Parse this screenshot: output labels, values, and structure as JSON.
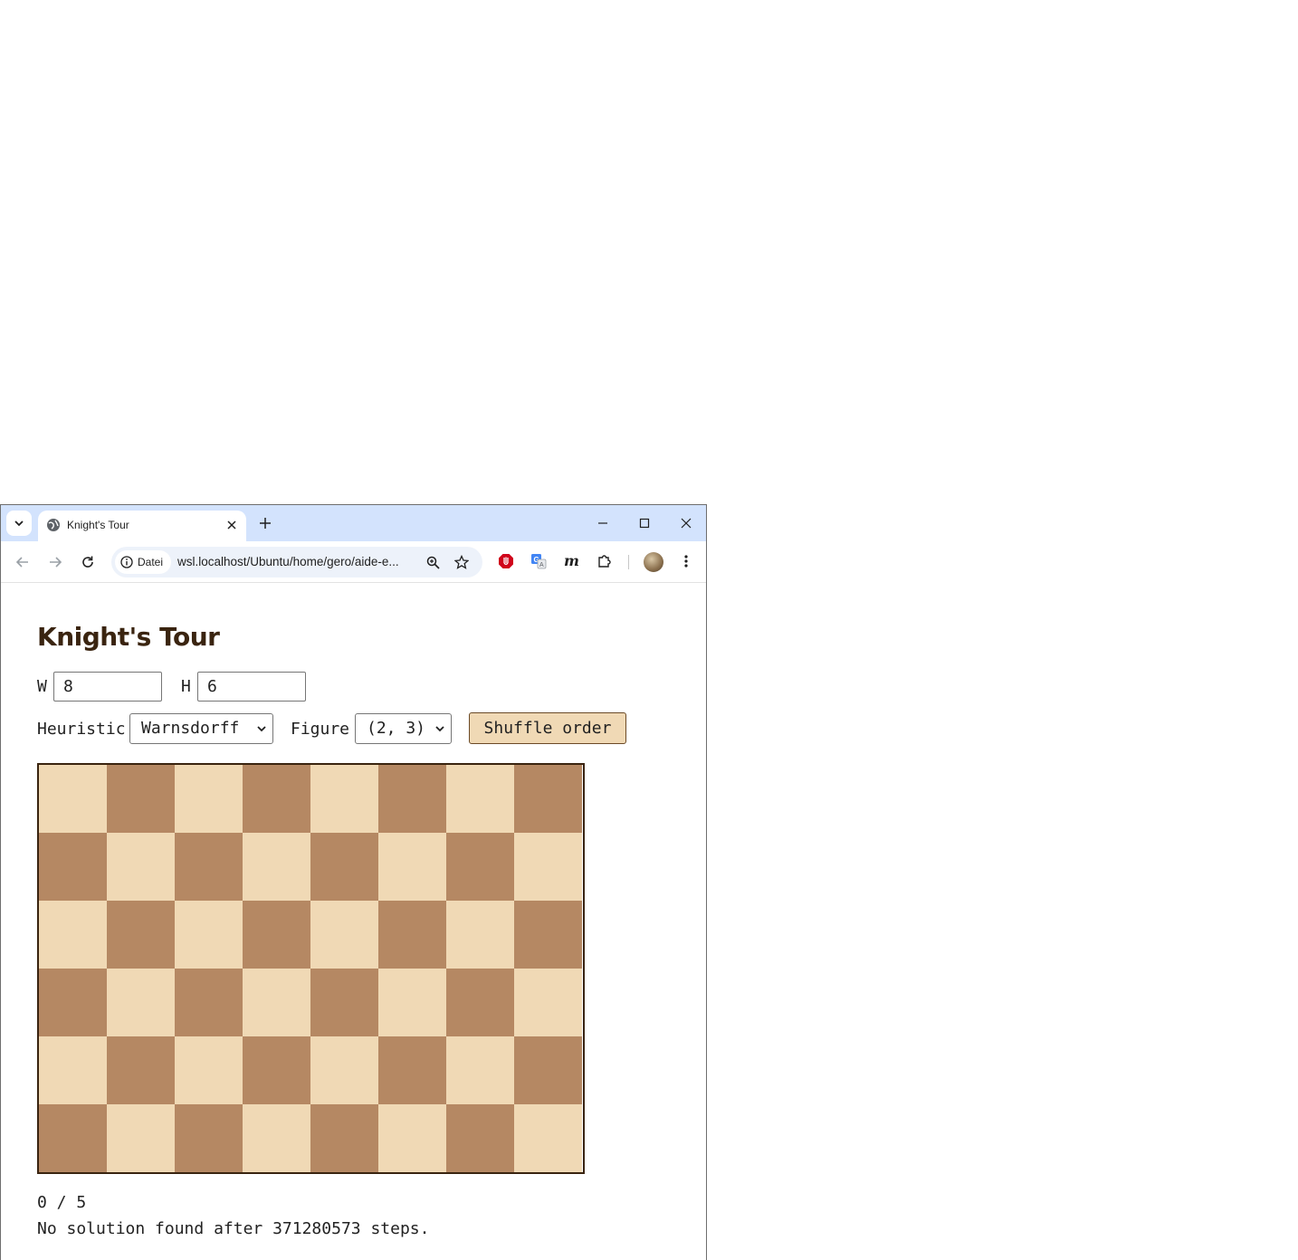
{
  "browser": {
    "tab_title": "Knight's Tour",
    "site_chip_label": "Datei",
    "url": "wsl.localhost/Ubuntu/home/gero/aide-e..."
  },
  "page": {
    "title": "Knight's Tour",
    "width_label": "W",
    "width_value": "8",
    "height_label": "H",
    "height_value": "6",
    "heuristic_label": "Heuristic",
    "heuristic_selected": "Warnsdorff",
    "figure_label": "Figure",
    "figure_selected": "(2, 3)",
    "shuffle_button": "Shuffle order",
    "progress": "0 / 5",
    "result": "No solution found after 371280573 steps."
  },
  "board": {
    "columns": 8,
    "rows": 6,
    "light_color": "#f0d9b5",
    "dark_color": "#b58863"
  },
  "icons": [
    "tab-search-icon",
    "globe-icon",
    "close-icon",
    "plus-icon",
    "minimize-icon",
    "maximize-icon",
    "window-close-icon",
    "back-icon",
    "forward-icon",
    "reload-icon",
    "info-icon",
    "zoom-icon",
    "star-icon",
    "adblock-icon",
    "translate-icon",
    "m-extension-icon",
    "puzzle-icon",
    "more-icon"
  ]
}
